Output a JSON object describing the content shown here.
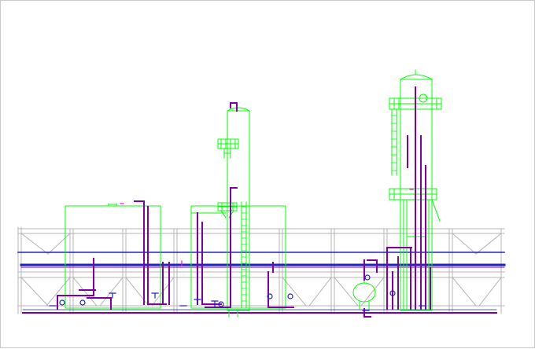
{
  "drawing": {
    "background": "#ffffff",
    "colors": {
      "steel": "#00ff00",
      "pipe": "#8000a0",
      "header": "#2020c0",
      "rack": "#b4b4b4",
      "valve": "#2020c0",
      "ground": "#7a00a8",
      "highlight": "#ff00ff"
    },
    "components": [
      "pipe-rack",
      "left-tank",
      "middle-column",
      "middle-frame",
      "right-column",
      "horizontal-drum",
      "piping",
      "valves"
    ]
  }
}
